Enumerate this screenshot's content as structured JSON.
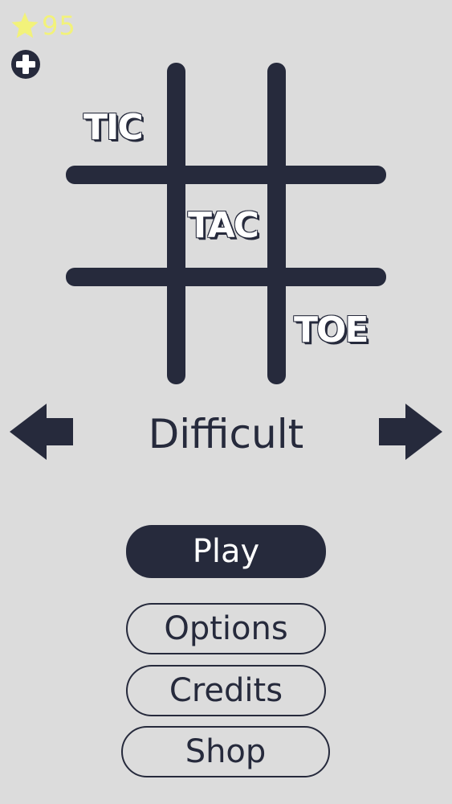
{
  "header": {
    "coins": "95",
    "coin_icon": "star-icon",
    "add_icon": "plus-circle-icon",
    "coin_color": "#f2f27a"
  },
  "title": {
    "words": [
      "TIC",
      "TAC",
      "TOE"
    ]
  },
  "difficulty": {
    "label": "Difficult",
    "prev_icon": "arrow-left-icon",
    "next_icon": "arrow-right-icon"
  },
  "menu": {
    "play": "Play",
    "options": "Options",
    "credits": "Credits",
    "shop": "Shop"
  },
  "colors": {
    "background": "#dcdcdc",
    "ink": "#262a3c",
    "text_light": "#ffffff"
  }
}
